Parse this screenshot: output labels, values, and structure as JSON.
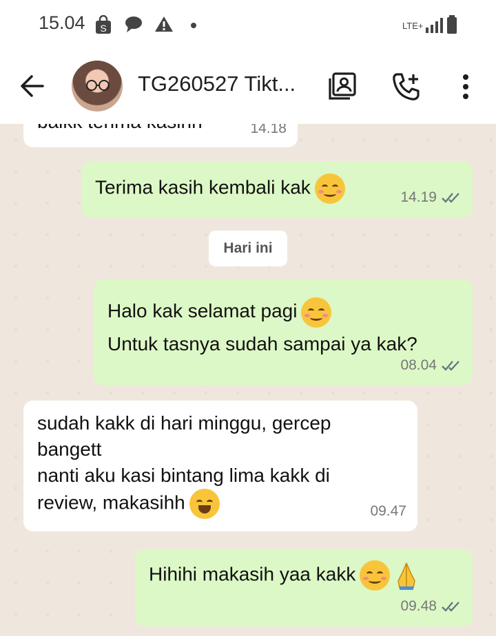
{
  "status_bar": {
    "time": "15.04",
    "network": "LTE+"
  },
  "header": {
    "contact_name": "TG260527 Tikt..."
  },
  "messages": [
    {
      "direction": "in",
      "text": "baikk terima kasihh",
      "time": "14.18"
    },
    {
      "direction": "out",
      "text": "Terima kasih kembali kak",
      "time": "14.19"
    },
    {
      "direction": "out",
      "line1": "Halo kak selamat pagi",
      "line2": "Untuk tasnya sudah sampai ya kak?",
      "time": "08.04"
    },
    {
      "direction": "in",
      "text": "sudah kakk di hari minggu, gercep\nbangett\nnanti aku kasi bintang lima kakk di\nreview, makasihh",
      "time": "09.47"
    },
    {
      "direction": "out",
      "text": "Hihihi makasih yaa kakk",
      "time": "09.48"
    }
  ],
  "date_divider": "Hari ini",
  "colors": {
    "incoming": "#ffffff",
    "outgoing": "#dcf8c6",
    "background": "#efe7dd",
    "tick": "#667781"
  }
}
